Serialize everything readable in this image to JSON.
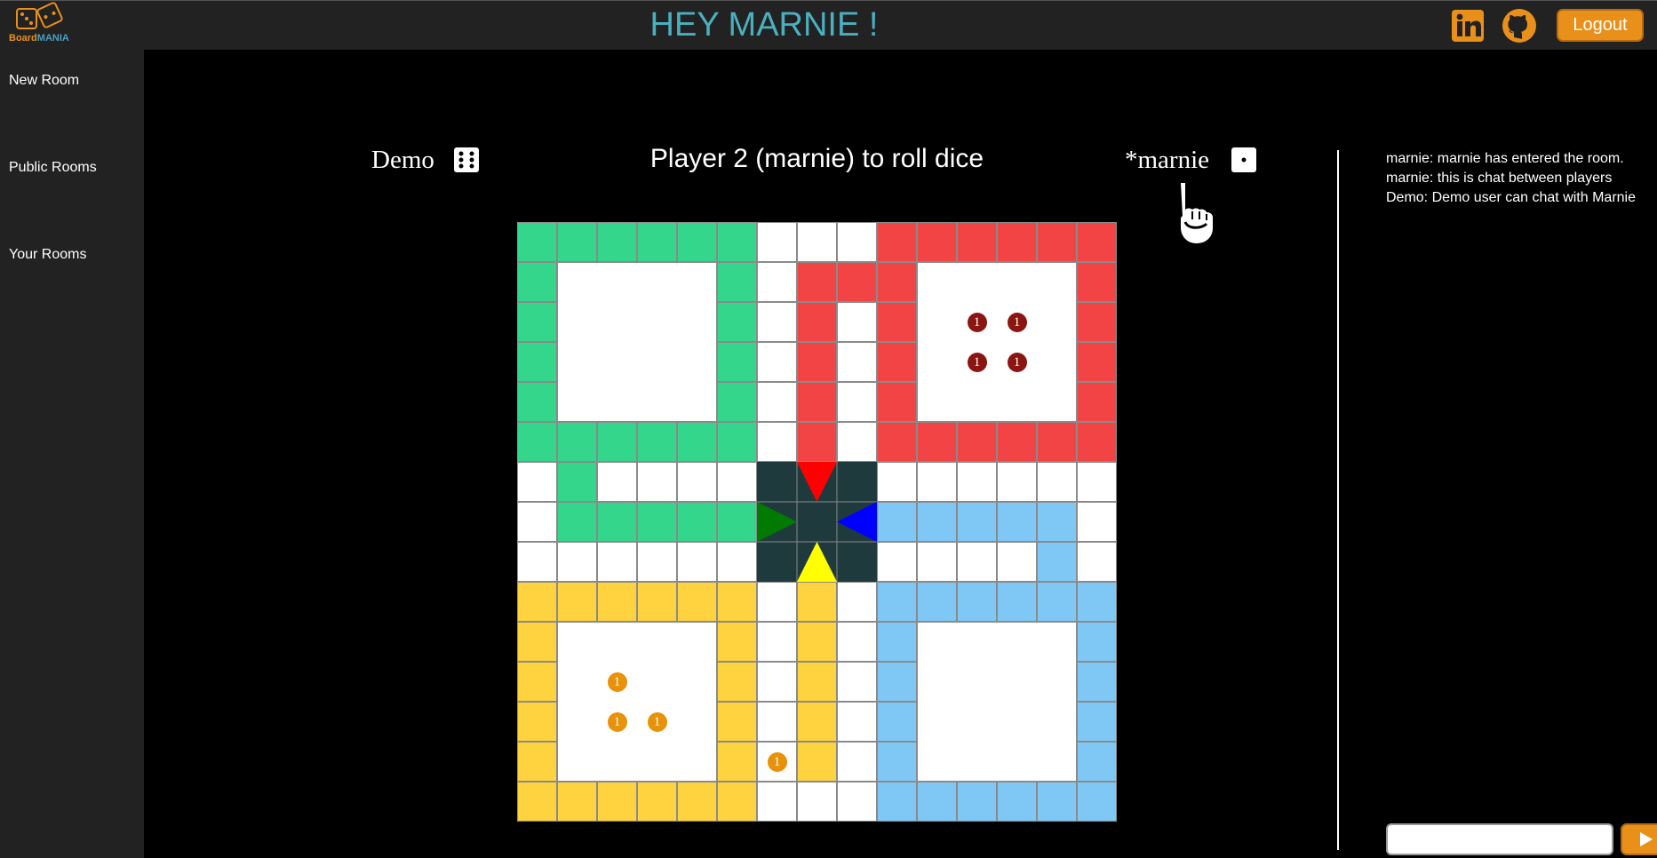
{
  "app": {
    "brand_board": "Board",
    "brand_mania": "MANIA",
    "greeting": "HEY MARNIE !",
    "logout_label": "Logout",
    "icons": [
      "dice-logo-icon",
      "linkedin-icon",
      "github-icon"
    ],
    "accent_color": "#e8901a",
    "greeting_color": "#4ab0c0"
  },
  "sidebar": {
    "items": [
      {
        "label": "New Room"
      },
      {
        "label": "Public Rooms"
      },
      {
        "label": "Your Rooms"
      }
    ]
  },
  "game": {
    "player1": {
      "name": "Demo",
      "die_value": 6
    },
    "player2": {
      "name": "*marnie",
      "die_value": 1
    },
    "turn_text": "Player 2 (marnie) to roll dice",
    "colors": {
      "green": "#33d68a",
      "red": "#f24444",
      "blue": "#7fc8f6",
      "yellow": "#ffd23f",
      "center": "#1f3a3d"
    },
    "tokens": [
      {
        "color": "red",
        "label": "1",
        "row": 2,
        "col": 11
      },
      {
        "color": "red",
        "label": "1",
        "row": 2,
        "col": 12
      },
      {
        "color": "red",
        "label": "1",
        "row": 3,
        "col": 11
      },
      {
        "color": "red",
        "label": "1",
        "row": 3,
        "col": 12
      },
      {
        "color": "yellow",
        "label": "1",
        "row": 11,
        "col": 2
      },
      {
        "color": "yellow",
        "label": "1",
        "row": 12,
        "col": 2
      },
      {
        "color": "yellow",
        "label": "1",
        "row": 12,
        "col": 3
      },
      {
        "color": "yellow",
        "label": "1",
        "row": 13,
        "col": 6
      }
    ]
  },
  "chat": {
    "messages": [
      "marnie: marnie has entered the room.",
      "marnie: this is chat between players",
      "Demo: Demo user can chat with Marnie"
    ],
    "input_value": ""
  }
}
